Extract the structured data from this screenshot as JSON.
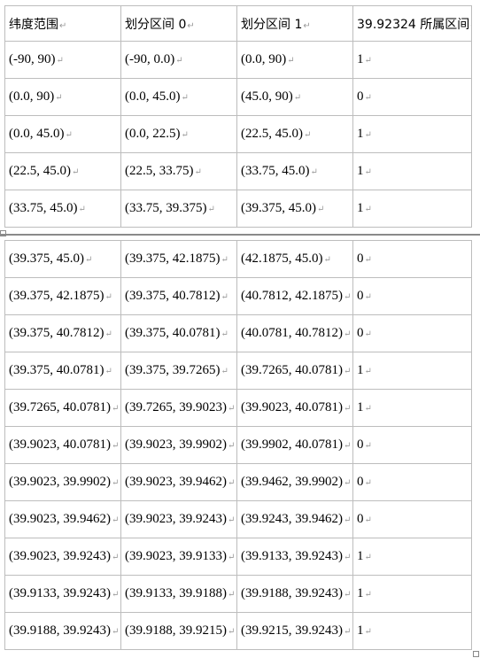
{
  "return_mark": "↵",
  "table_top": {
    "header": [
      "纬度范围",
      "划分区间 0",
      "划分区间 1",
      "39.92324 所属区间"
    ],
    "rows": [
      [
        "(-90, 90)",
        "(-90, 0.0)",
        "(0.0, 90)",
        "1"
      ],
      [
        "(0.0, 90)",
        "(0.0, 45.0)",
        "(45.0, 90)",
        "0"
      ],
      [
        "(0.0, 45.0)",
        "(0.0, 22.5)",
        "(22.5, 45.0)",
        "1"
      ],
      [
        "(22.5, 45.0)",
        "(22.5, 33.75)",
        "(33.75, 45.0)",
        "1"
      ],
      [
        "(33.75, 45.0)",
        "(33.75, 39.375)",
        "(39.375, 45.0)",
        "1"
      ]
    ]
  },
  "table_bottom": {
    "rows": [
      [
        "(39.375, 45.0)",
        "(39.375, 42.1875)",
        "(42.1875, 45.0)",
        "0"
      ],
      [
        "(39.375, 42.1875)",
        "(39.375, 40.7812)",
        "(40.7812, 42.1875)",
        "0"
      ],
      [
        "(39.375, 40.7812)",
        "(39.375, 40.0781)",
        "(40.0781, 40.7812)",
        "0"
      ],
      [
        "(39.375, 40.0781)",
        "(39.375, 39.7265)",
        "(39.7265, 40.0781)",
        "1"
      ],
      [
        "(39.7265, 40.0781)",
        "(39.7265, 39.9023)",
        "(39.9023, 40.0781)",
        "1"
      ],
      [
        "(39.9023, 40.0781)",
        "(39.9023, 39.9902)",
        "(39.9902, 40.0781)",
        "0"
      ],
      [
        "(39.9023, 39.9902)",
        "(39.9023, 39.9462)",
        "(39.9462, 39.9902)",
        "0"
      ],
      [
        "(39.9023, 39.9462)",
        "(39.9023, 39.9243)",
        "(39.9243, 39.9462)",
        "0"
      ],
      [
        "(39.9023, 39.9243)",
        "(39.9023, 39.9133)",
        "(39.9133, 39.9243)",
        "1"
      ],
      [
        "(39.9133, 39.9243)",
        "(39.9133, 39.9188)",
        "(39.9188, 39.9243)",
        "1"
      ],
      [
        "(39.9188, 39.9243)",
        "(39.9188, 39.9215)",
        "(39.9215, 39.9243)",
        "1"
      ]
    ]
  }
}
